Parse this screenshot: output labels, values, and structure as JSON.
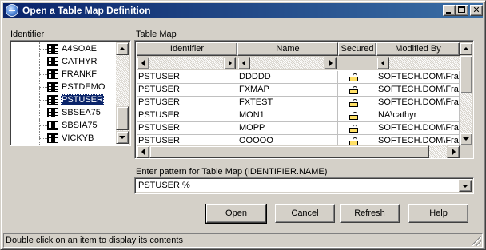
{
  "window": {
    "title": "Open a Table Map Definition",
    "minimize_icon": "minimize-icon",
    "maximize_icon": "maximize-icon",
    "close_icon": "close-icon",
    "title_color": "#0a246a"
  },
  "identifier_panel": {
    "label": "Identifier",
    "items": [
      {
        "label": "A4SOAE",
        "selected": false
      },
      {
        "label": "CATHYR",
        "selected": false
      },
      {
        "label": "FRANKF",
        "selected": false
      },
      {
        "label": "PSTDEMO",
        "selected": false
      },
      {
        "label": "PSTUSER",
        "selected": true
      },
      {
        "label": "SBSEA75",
        "selected": false
      },
      {
        "label": "SBSIA75",
        "selected": false
      },
      {
        "label": "VICKYB",
        "selected": false
      }
    ],
    "item_icon": "database-icon"
  },
  "table_map": {
    "label": "Table Map",
    "columns": [
      "Identifier",
      "Name",
      "Secured",
      "Modified By"
    ],
    "rows": [
      {
        "identifier": "PSTUSER",
        "name": "DDDDD",
        "secured": true,
        "modified_by": "SOFTECH.DOM\\Frank"
      },
      {
        "identifier": "PSTUSER",
        "name": "FXMAP",
        "secured": true,
        "modified_by": "SOFTECH.DOM\\Frank"
      },
      {
        "identifier": "PSTUSER",
        "name": "FXTEST",
        "secured": true,
        "modified_by": "SOFTECH.DOM\\Frank"
      },
      {
        "identifier": "PSTUSER",
        "name": "MON1",
        "secured": true,
        "modified_by": "NA\\cathyr"
      },
      {
        "identifier": "PSTUSER",
        "name": "MOPP",
        "secured": true,
        "modified_by": "SOFTECH.DOM\\Frank"
      },
      {
        "identifier": "PSTUSER",
        "name": "OOOOO",
        "secured": true,
        "modified_by": "SOFTECH.DOM\\Frank"
      }
    ],
    "secured_icon": "lock-icon"
  },
  "pattern": {
    "label": "Enter pattern for Table Map (IDENTIFIER.NAME)",
    "value": "PSTUSER.%"
  },
  "buttons": {
    "open": "Open",
    "cancel": "Cancel",
    "refresh": "Refresh",
    "help": "Help"
  },
  "status": {
    "text": "Double click on an item to display its contents"
  }
}
